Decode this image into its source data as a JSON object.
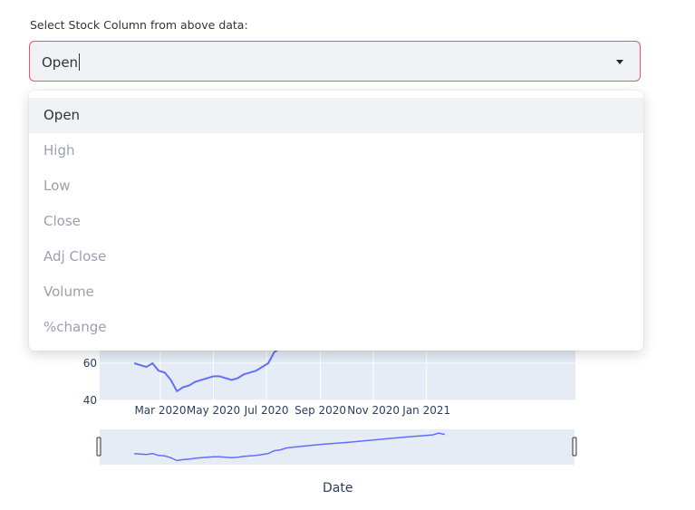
{
  "select": {
    "label": "Select Stock Column from above data:",
    "value": "Open",
    "options": [
      "Open",
      "High",
      "Low",
      "Close",
      "Adj Close",
      "Volume",
      "%change"
    ],
    "selected_index": 0,
    "border_color": "#f0506e",
    "arrow_icon": "caret-down-icon"
  },
  "chart_data": {
    "type": "line",
    "xlabel": "Date",
    "ylabel": "",
    "x_ticks": [
      "Mar 2020",
      "May 2020",
      "Jul 2020",
      "Sep 2020",
      "Nov 2020",
      "Jan 2021"
    ],
    "y_ticks": [
      "40",
      "60"
    ],
    "line_color": "#636efa",
    "plot_background": "#e5ecf6",
    "series": [
      {
        "x": [
          "2020-01-31",
          "2020-02-07",
          "2020-02-14",
          "2020-02-21",
          "2020-02-28",
          "2020-03-06",
          "2020-03-13",
          "2020-03-20",
          "2020-03-27",
          "2020-04-03",
          "2020-04-10",
          "2020-04-17",
          "2020-04-24",
          "2020-05-01",
          "2020-05-08",
          "2020-05-15",
          "2020-05-22",
          "2020-05-29",
          "2020-06-05",
          "2020-06-12",
          "2020-06-19",
          "2020-06-26",
          "2020-07-03",
          "2020-07-10",
          "2020-07-17",
          "2020-07-24",
          "2020-08-07",
          "2020-09-04",
          "2020-10-02",
          "2020-11-06",
          "2020-12-04",
          "2021-01-08",
          "2021-01-15",
          "2021-01-22"
        ],
        "values": [
          60,
          59,
          58,
          60,
          56,
          55,
          51,
          45,
          47,
          48,
          50,
          51,
          52,
          53,
          53,
          52,
          51,
          52,
          54,
          55,
          56,
          58,
          60,
          66,
          68,
          72,
          75,
          80,
          84,
          90,
          95,
          100,
          104,
          101
        ]
      }
    ],
    "range_slider": true,
    "ylim": [
      40,
      70
    ]
  }
}
